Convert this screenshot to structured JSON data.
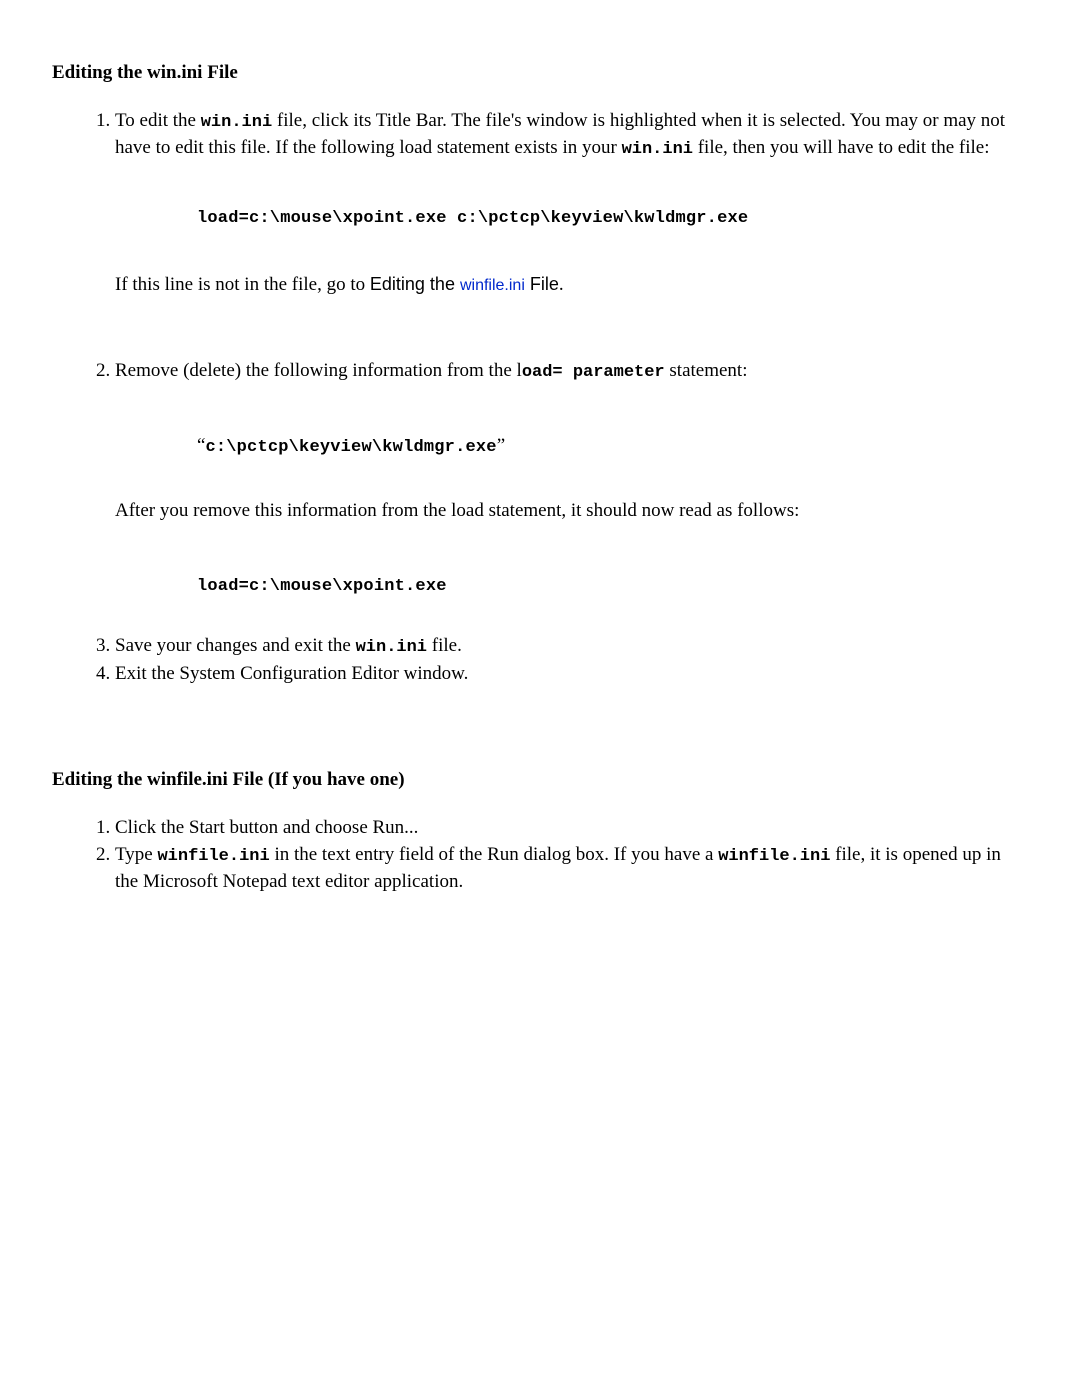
{
  "section1": {
    "heading": "Editing the win.ini File",
    "item1": {
      "pre": "To edit the ",
      "code1": "win.ini",
      "mid": " file, click its Title Bar. The file's window is highlighted when it is selected. You may or may not have to edit this file. If the following load statement exists in your ",
      "code2": "win.ini",
      "post": " file, then you will have to edit the file:",
      "codeBlock": "load=c:\\mouse\\xpoint.exe c:\\pctcp\\keyview\\kwldmgr.exe",
      "followPre": "If this line is not in the file, go to ",
      "followSans": "Editing the ",
      "followLink": "winfile.ini",
      "followSansPost": " File",
      "followEnd": "."
    },
    "item2": {
      "pre": "Remove (delete) the following information from the l",
      "codeA": "oad= parameter",
      "mid": " statement:",
      "q1": "“",
      "codeBlock": "c:\\pctcp\\keyview\\kwldmgr.exe",
      "q2": "”",
      "afterPre": "After you remove this information from the load statement, it should now read as follows:",
      "codeBlock2": "load=c:\\mouse\\xpoint.exe"
    },
    "item3": {
      "pre": "Save your changes and exit the ",
      "code": "win.ini",
      "post": " file."
    },
    "item4": {
      "text": "Exit the System Configuration Editor window."
    }
  },
  "section2": {
    "heading": "Editing the winfile.ini File (If you have one)",
    "item1": {
      "text": "Click the Start button and choose Run..."
    },
    "item2": {
      "pre": "Type ",
      "code1": "winfile.ini",
      "mid": "  in the text entry field of the Run dialog box. If you have a ",
      "code2": "winfile.ini",
      "post": " file, it is opened up in the Microsoft Notepad text editor application."
    }
  }
}
